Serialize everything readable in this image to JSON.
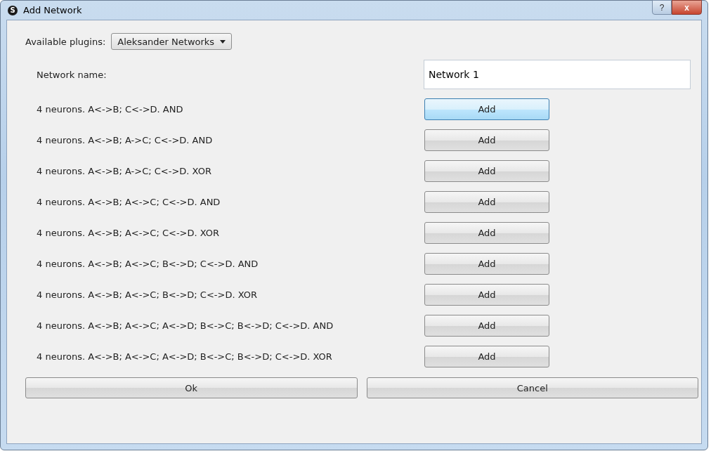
{
  "window": {
    "title": "Add Network",
    "icon_letter": "S",
    "help_label": "?",
    "close_label": "x"
  },
  "plugins": {
    "label": "Available plugins:",
    "value": "Aleksander Networks"
  },
  "network_name": {
    "label": "Network name:",
    "value": "Network 1"
  },
  "networks": [
    {
      "label": "4 neurons. A<->B; C<->D. AND",
      "button": "Add",
      "focused": true
    },
    {
      "label": "4 neurons. A<->B; A->C; C<->D. AND",
      "button": "Add",
      "focused": false
    },
    {
      "label": "4 neurons. A<->B; A->C; C<->D. XOR",
      "button": "Add",
      "focused": false
    },
    {
      "label": "4 neurons. A<->B; A<->C; C<->D. AND",
      "button": "Add",
      "focused": false
    },
    {
      "label": "4 neurons. A<->B; A<->C; C<->D. XOR",
      "button": "Add",
      "focused": false
    },
    {
      "label": "4 neurons. A<->B; A<->C; B<->D; C<->D. AND",
      "button": "Add",
      "focused": false
    },
    {
      "label": "4 neurons. A<->B; A<->C; B<->D; C<->D. XOR",
      "button": "Add",
      "focused": false
    },
    {
      "label": "4 neurons. A<->B; A<->C; A<->D; B<->C; B<->D; C<->D. AND",
      "button": "Add",
      "focused": false
    },
    {
      "label": "4 neurons. A<->B; A<->C; A<->D; B<->C; B<->D; C<->D. XOR",
      "button": "Add",
      "focused": false
    }
  ],
  "buttons": [
    "Ok",
    "Cancel"
  ]
}
